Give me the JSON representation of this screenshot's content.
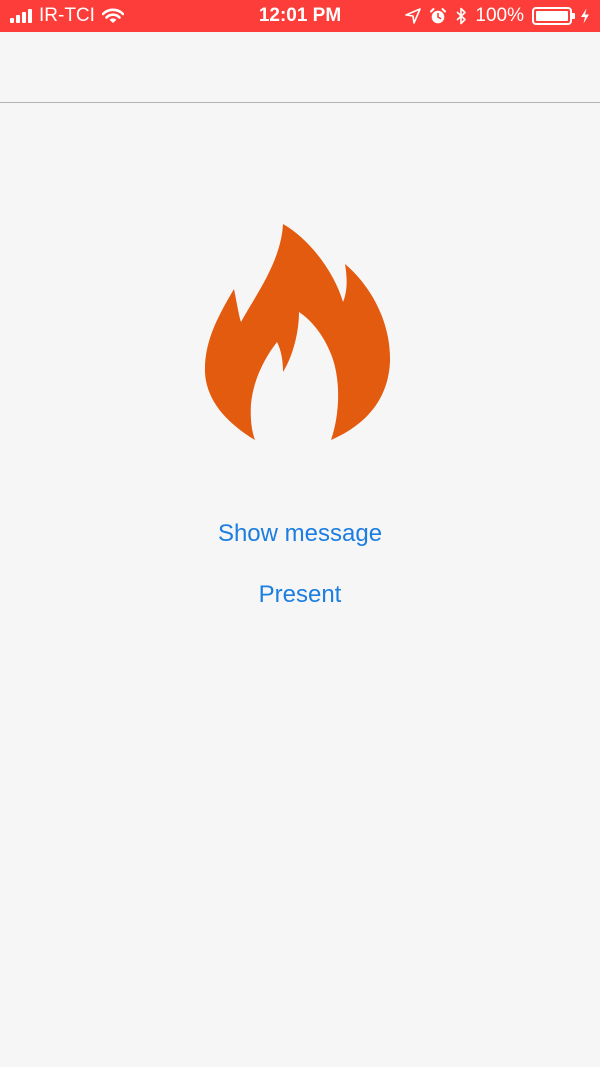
{
  "status_bar": {
    "carrier": "IR-TCI",
    "time": "12:01 PM",
    "battery_percent": "100%",
    "battery_level": 1.0,
    "icons": [
      "signal-icon",
      "wifi-icon",
      "location-icon",
      "alarm-icon",
      "bluetooth-icon",
      "battery-icon",
      "charging-icon"
    ],
    "color": "#fc3d39"
  },
  "nav_bar": {
    "title": ""
  },
  "main": {
    "illustration": "flame-icon",
    "flame_color": "#e35b0e",
    "buttons": {
      "show_message": "Show message",
      "present": "Present"
    },
    "button_color": "#1b7ee0"
  }
}
